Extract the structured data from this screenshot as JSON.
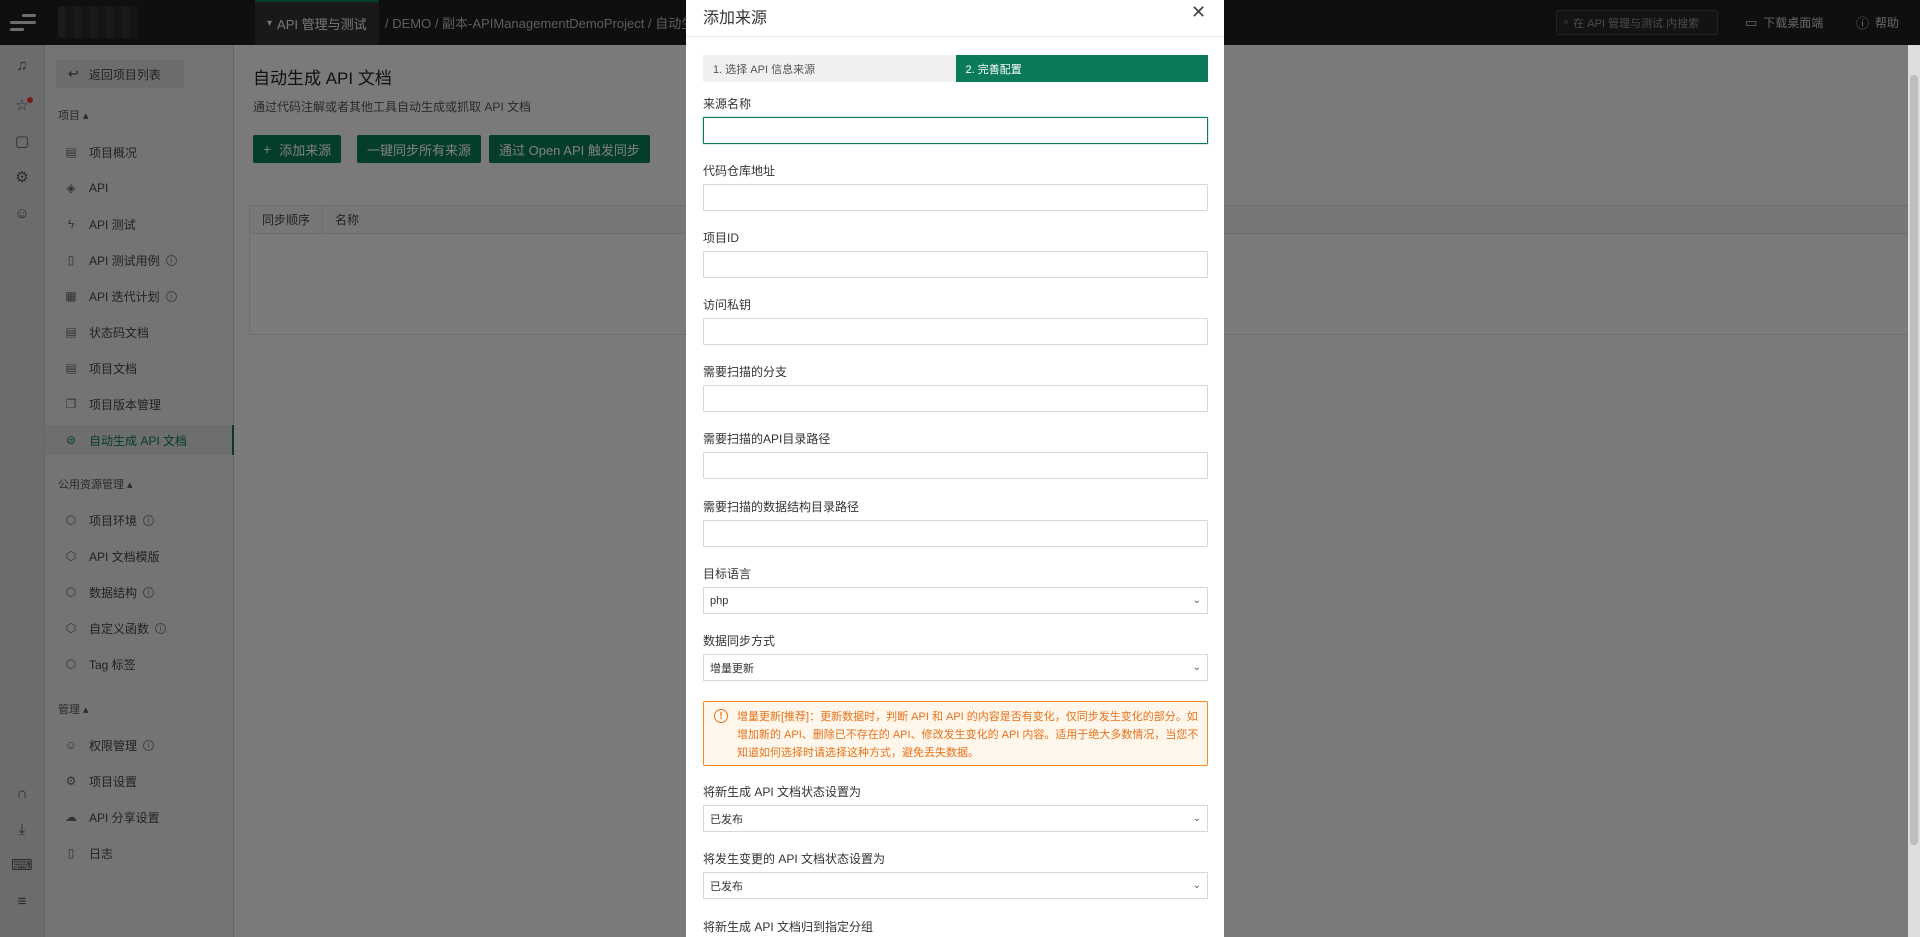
{
  "topbar": {
    "active_tab": "API 管理与测试",
    "breadcrumb": "/ DEMO / 副本-APIManagementDemoProject / 自动生",
    "search_placeholder": "在 API 管理与测试 内搜索",
    "download_label": "下载桌面端",
    "help_label": "帮助"
  },
  "sidebar": {
    "back_label": "返回项目列表",
    "group_project": "项目",
    "project_items": [
      {
        "label": "项目概况"
      },
      {
        "label": "API"
      },
      {
        "label": "API 测试"
      },
      {
        "label": "API 测试用例"
      },
      {
        "label": "API 迭代计划"
      },
      {
        "label": "状态码文档"
      },
      {
        "label": "项目文档"
      },
      {
        "label": "项目版本管理"
      },
      {
        "label": "自动生成 API 文档"
      }
    ],
    "group_public": "公用资源管理",
    "public_items": [
      {
        "label": "项目环境"
      },
      {
        "label": "API 文档模版"
      },
      {
        "label": "数据结构"
      },
      {
        "label": "自定义函数"
      },
      {
        "label": "Tag 标签"
      }
    ],
    "group_manage": "管理",
    "manage_items": [
      {
        "label": "权限管理"
      },
      {
        "label": "项目设置"
      },
      {
        "label": "API 分享设置"
      },
      {
        "label": "日志"
      }
    ]
  },
  "main": {
    "title": "自动生成 API 文档",
    "description": "通过代码注解或者其他工具自动生成或抓取 API 文档",
    "add_source": "添加来源",
    "sync_all": "一键同步所有来源",
    "openapi_sync": "通过 Open API 触发同步",
    "table_headers": [
      "同步顺序",
      "名称"
    ]
  },
  "modal": {
    "title": "添加来源",
    "step1": "1. 选择 API 信息来源",
    "step2": "2. 完善配置",
    "fields": {
      "source_name": "来源名称",
      "repo_url": "代码仓库地址",
      "project_id": "项目ID",
      "access_key": "访问私钥",
      "branch": "需要扫描的分支",
      "api_dir": "需要扫描的API目录路径",
      "struct_dir": "需要扫描的数据结构目录路径",
      "language": "目标语言",
      "sync_mode": "数据同步方式",
      "new_status": "将新生成 API 文档状态设置为",
      "changed_status": "将发生变更的 API 文档状态设置为",
      "group": "将新生成 API 文档归到指定分组"
    },
    "values": {
      "language": "php",
      "sync_mode": "增量更新",
      "new_status": "已发布",
      "changed_status": "已发布"
    },
    "warning": "增量更新[推荐]：更新数据时，判断 API 和 API 的内容是否有变化，仅同步发生变化的部分。如增加新的 API、删除已不存在的 API、修改发生变化的 API 内容。适用于绝大多数情况，当您不知道如何选择时请选择这种方式，避免丢失数据。"
  }
}
